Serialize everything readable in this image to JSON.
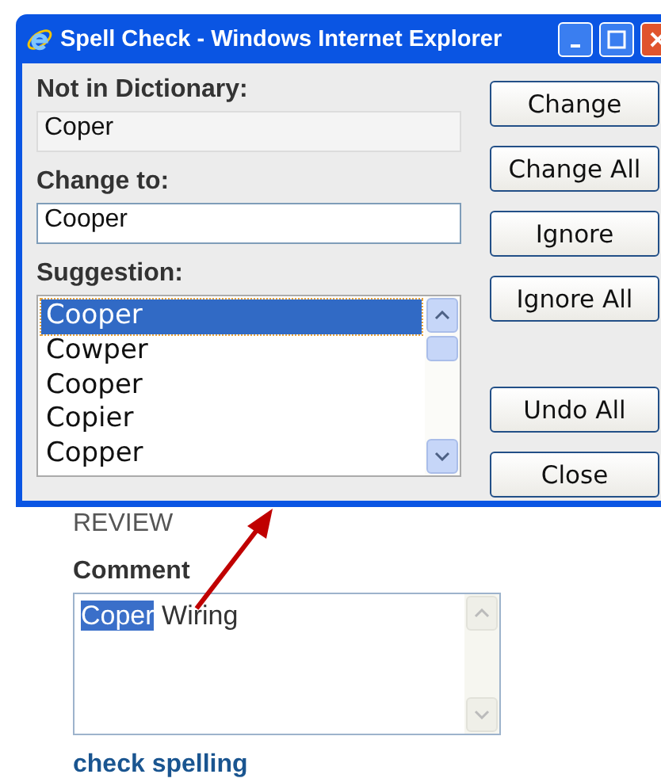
{
  "dialog": {
    "title": "Spell Check - Windows Internet Explorer",
    "not_in_dictionary": {
      "label": "Not in Dictionary:",
      "value": "Coper"
    },
    "change_to": {
      "label": "Change to:",
      "value": "Cooper"
    },
    "suggestions": {
      "label": "Suggestion:",
      "items": [
        {
          "text": "Cooper",
          "selected": true
        },
        {
          "text": "Cowper",
          "selected": false
        },
        {
          "text": "Cooper",
          "selected": false
        },
        {
          "text": "Copier",
          "selected": false
        },
        {
          "text": "Copper",
          "selected": false
        }
      ]
    },
    "buttons": [
      "Change",
      "Change All",
      "Ignore",
      "Ignore All"
    ],
    "lower_buttons": [
      "Undo All",
      "Close"
    ]
  },
  "page": {
    "status": "REVIEW",
    "comment": {
      "label": "Comment",
      "parts": [
        {
          "text": "Coper",
          "highlighted": true
        },
        {
          "text": " Wiring",
          "highlighted": false
        }
      ]
    },
    "link": "check spelling"
  }
}
